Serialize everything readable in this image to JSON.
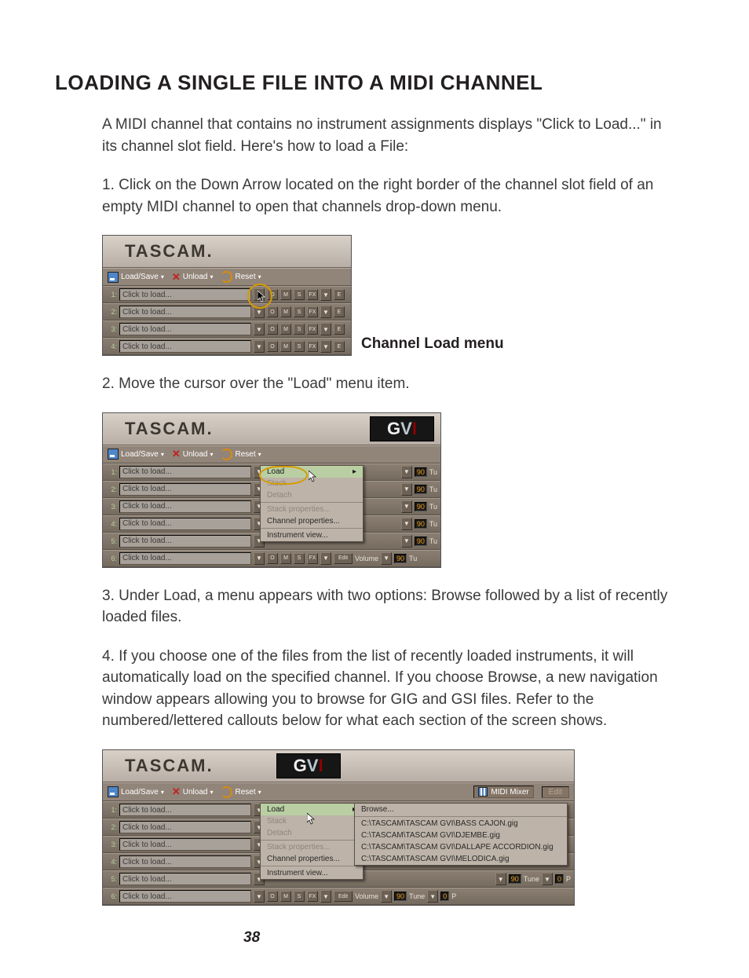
{
  "heading": "LOADING A SINGLE FILE INTO A MIDI CHANNEL",
  "para1": "A MIDI channel that contains no instrument assignments displays \"Click to Load...\" in its channel slot field.  Here's how to load a File:",
  "step1": "1. Click on the Down Arrow located on the right border of the channel slot field of an empty MIDI channel to open that channels drop-down menu.",
  "caption1": "Channel Load menu",
  "step2": "2. Move the cursor over the \"Load\" menu item.",
  "step3": "3. Under Load, a menu appears with two options: Browse followed by a list of recently loaded files.",
  "step4": "4. If you choose one of the files from the list of recently loaded instruments, it will automatically load on the specified channel. If you choose Browse, a new navigation window appears allowing you to browse for GIG and GSI files. Refer to the numbered/lettered callouts below for what each section of the screen shows.",
  "page_number": "38",
  "ui": {
    "brand": "TASCAM.",
    "gvi": "GVI",
    "toolbar": {
      "load_save": "Load/Save",
      "unload": "Unload",
      "reset": "Reset",
      "midi_mixer": "MIDI Mixer",
      "edit": "Edit"
    },
    "slot_text": "Click to load...",
    "context_menu": {
      "load": "Load",
      "stack": "Stack",
      "detach": "Detach",
      "stack_props": "Stack properties...",
      "channel_props": "Channel properties...",
      "inst_view": "Instrument view..."
    },
    "row_btns": {
      "o": "O",
      "m": "M",
      "s": "S",
      "fx": "FX",
      "e": "E",
      "edit": "Edit",
      "volume": "Volume"
    },
    "vals": {
      "ninety": "90",
      "zero": "0",
      "tune": "Tune",
      "tu": "Tu",
      "p": "P"
    },
    "submenu": {
      "browse": "Browse...",
      "recent": [
        "C:\\TASCAM\\TASCAM GVI\\BASS CAJON.gig",
        "C:\\TASCAM\\TASCAM GVI\\DJEMBE.gig",
        "C:\\TASCAM\\TASCAM GVI\\DALLAPE ACCORDION.gig",
        "C:\\TASCAM\\TASCAM GVI\\MELODICA.gig"
      ]
    }
  }
}
